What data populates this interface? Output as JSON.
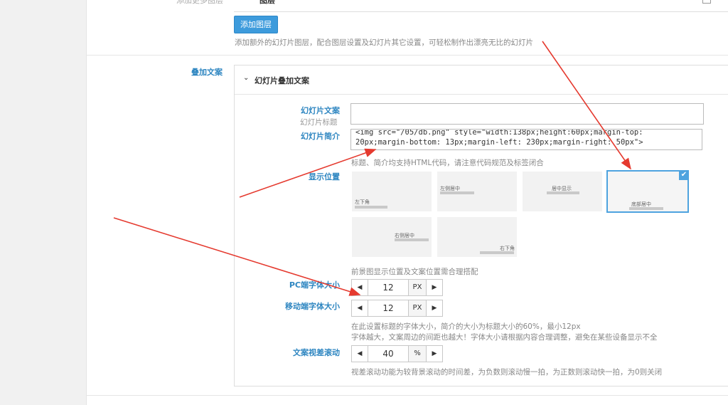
{
  "top": {
    "partial_label": "添加更多图层",
    "partial_value": "图层",
    "add_layer_button": "添加图层",
    "add_layer_hint": "添加额外的幻灯片图层，配合图层设置及幻灯片其它设置，可轻松制作出漂亮无比的幻灯片"
  },
  "overlay": {
    "section_label": "叠加文案",
    "panel_title": "幻灯片叠加文案",
    "caption_label": "幻灯片文案",
    "caption_sub": "幻灯片标题",
    "caption_value": "",
    "intro_label": "幻灯片简介",
    "intro_value": "<img src=\"/05/db.png\" style=\"width:138px;height:60px;margin-top: 20px;margin-bottom: 13px;margin-left: 230px;margin-right: 50px\">",
    "intro_hint": "标题、简介均支持HTML代码，请注意代码规范及标签闭合",
    "position_label": "显示位置",
    "positions": [
      "左下角",
      "左侧居中",
      "居中显示",
      "底部居中",
      "右侧居中",
      "右下角"
    ],
    "selected_position": "底部居中",
    "position_hint": "前景图显示位置及文案位置需合理搭配",
    "pc_font_label": "PC端字体大小",
    "pc_font_value": "12",
    "pc_font_unit": "PX",
    "mobile_font_label": "移动端字体大小",
    "mobile_font_value": "12",
    "mobile_font_unit": "PX",
    "font_hint_1": "在此设置标题的字体大小，简介的大小为标题大小的60%，最小12px",
    "font_hint_2": "字体越大，文案周边的间距也越大！字体大小请根据内容合理调整，避免在某些设备显示不全",
    "parallax_label": "文案视差滚动",
    "parallax_value": "40",
    "parallax_unit": "%",
    "parallax_hint": "视差滚动功能为较背景滚动的时间差，为负数则滚动慢一拍，为正数则滚动快一拍，为0则关闭"
  },
  "colors": {
    "accent": "#2e86c1",
    "arrow": "#e53a2f",
    "selected": "#4ea3df"
  },
  "icons": {
    "chevron": "chevron-down-icon",
    "check": "check-icon",
    "left": "triangle-left-icon",
    "right": "triangle-right-icon"
  }
}
